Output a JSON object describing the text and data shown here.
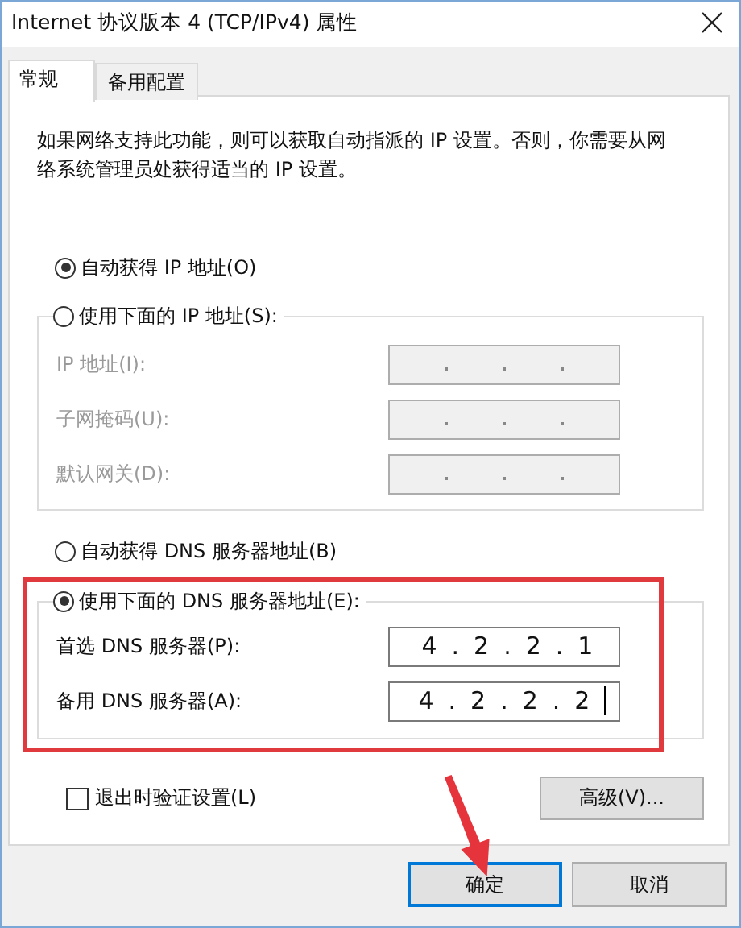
{
  "window": {
    "title": "Internet 协议版本 4 (TCP/IPv4) 属性"
  },
  "tabs": [
    {
      "label": "常规",
      "selected": true
    },
    {
      "label": "备用配置",
      "selected": false
    }
  ],
  "description": "如果网络支持此功能，则可以获取自动指派的 IP 设置。否则，你需要从网络系统管理员处获得适当的 IP 设置。",
  "ip": {
    "auto_option": {
      "label": "自动获得 IP 地址(O)",
      "selected": true
    },
    "manual_option": {
      "label": "使用下面的 IP 地址(S):",
      "selected": false
    },
    "fields": [
      {
        "label": "IP 地址(I):",
        "disabled": true
      },
      {
        "label": "子网掩码(U):",
        "disabled": true
      },
      {
        "label": "默认网关(D):",
        "disabled": true
      }
    ]
  },
  "dns": {
    "auto_option": {
      "label": "自动获得 DNS 服务器地址(B)",
      "selected": false
    },
    "manual_option": {
      "label": "使用下面的 DNS 服务器地址(E):",
      "selected": true
    },
    "fields": [
      {
        "label": "首选 DNS 服务器(P):",
        "disabled": false,
        "value": "4.2.2.1",
        "focused": false
      },
      {
        "label": "备用 DNS 服务器(A):",
        "disabled": false,
        "value": "4.2.2.2",
        "focused": true
      }
    ]
  },
  "validate_checkbox": {
    "label": "退出时验证设置(L)",
    "checked": false
  },
  "advanced_button": "高级(V)...",
  "buttons": [
    {
      "label": "确定",
      "default": true
    },
    {
      "label": "取消",
      "default": false
    }
  ]
}
